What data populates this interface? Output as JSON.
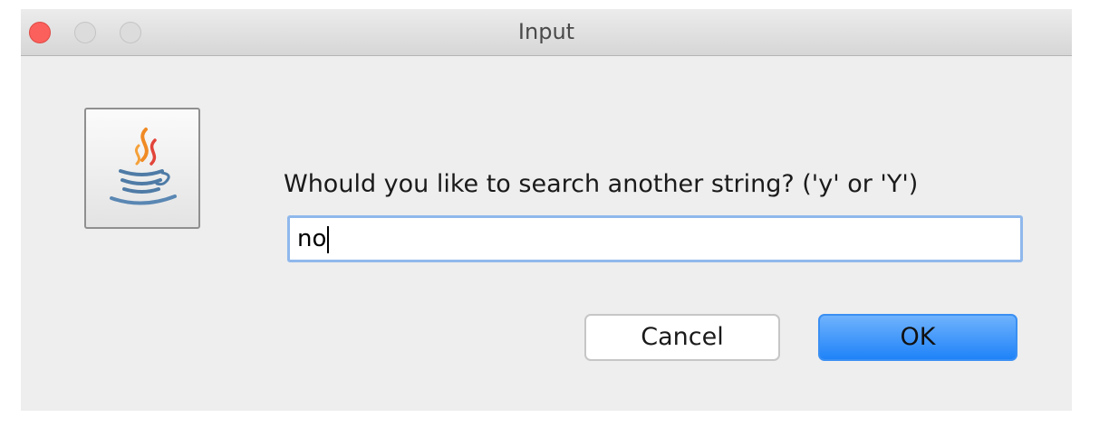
{
  "window": {
    "title": "Input"
  },
  "dialog": {
    "icon": "java-coffee-cup-icon",
    "message": "Whould you like to search another string?  ('y' or 'Y')",
    "input_value": "no",
    "cancel_label": "Cancel",
    "ok_label": "OK"
  },
  "colors": {
    "ok_button": "#1f83f8",
    "input_focus_border": "#8fb8ec",
    "close_button": "#fc605c"
  }
}
